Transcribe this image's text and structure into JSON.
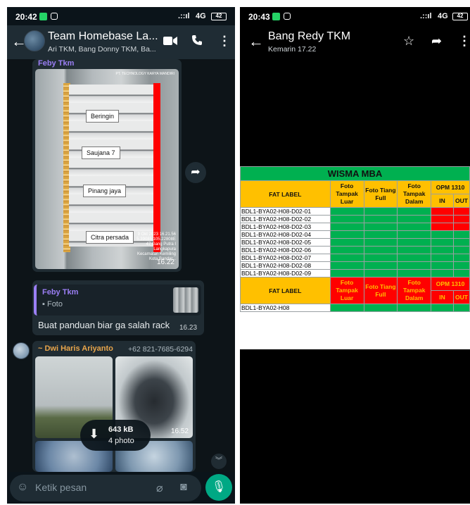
{
  "left": {
    "status": {
      "time": "20:42",
      "network": "4G",
      "battery": "42"
    },
    "header": {
      "title": "Team Homebase La...",
      "subtitle": "Ari TKM, Bang Donny TKM, Ba..."
    },
    "msg1": {
      "sender": "Feby Tkm",
      "photo": {
        "watermark_title": "PT. TECHNOLOGY KARYA MANDIRI",
        "labels": [
          "Beringin",
          "Saujana 7",
          "Pinang jaya",
          "Citra persada"
        ],
        "watermark_lines": [
          "9 Okt 2023 16.21.56",
          "5.39085 105.22808E",
          "47 Gang Putra I",
          "Langkapura",
          "Kecamatan Kemiling",
          "Kota Bandar..."
        ]
      },
      "time": "16.22"
    },
    "msg2": {
      "quote_name": "Feby Tkm",
      "quote_type": "Foto",
      "text": "Buat panduan biar ga salah rack",
      "time": "16.23"
    },
    "msg3": {
      "sender": "~ Dwi Haris Ariyanto",
      "phone": "+62 821-7685-6294",
      "photo_time": "16.52",
      "download_size": "643 kB",
      "download_count": "4 photo"
    },
    "input": {
      "placeholder": "Ketik pesan"
    }
  },
  "right": {
    "status": {
      "time": "20:43",
      "network": "4G",
      "battery": "42"
    },
    "header": {
      "title": "Bang Redy TKM",
      "subtitle": "Kemarin 17.22"
    },
    "chart_data": {
      "type": "table",
      "title": "WISMA MBA",
      "columns": [
        "FAT LABEL",
        "Foto Tampak Luar",
        "Foto Tiang Full",
        "Foto Tampak Dalam",
        "OPM 1310 IN",
        "OPM 1310 OUT"
      ],
      "rows": [
        {
          "label": "BDL1-BYA02-H08-D02-01",
          "cells": [
            "green",
            "green",
            "green",
            "red",
            "red"
          ]
        },
        {
          "label": "BDL1-BYA02-H08-D02-02",
          "cells": [
            "green",
            "green",
            "green",
            "red",
            "red"
          ]
        },
        {
          "label": "BDL1-BYA02-H08-D02-03",
          "cells": [
            "green",
            "green",
            "green",
            "red",
            "red"
          ]
        },
        {
          "label": "BDL1-BYA02-H08-D02-04",
          "cells": [
            "green",
            "green",
            "green",
            "green",
            "green"
          ]
        },
        {
          "label": "BDL1-BYA02-H08-D02-05",
          "cells": [
            "green",
            "green",
            "green",
            "green",
            "green"
          ]
        },
        {
          "label": "BDL1-BYA02-H08-D02-06",
          "cells": [
            "green",
            "green",
            "green",
            "green",
            "green"
          ]
        },
        {
          "label": "BDL1-BYA02-H08-D02-07",
          "cells": [
            "green",
            "green",
            "green",
            "green",
            "green"
          ]
        },
        {
          "label": "BDL1-BYA02-H08-D02-08",
          "cells": [
            "green",
            "green",
            "green",
            "green",
            "green"
          ]
        },
        {
          "label": "BDL1-BYA02-H08-D02-09",
          "cells": [
            "green",
            "green",
            "green",
            "green",
            "green"
          ]
        }
      ],
      "second_header": {
        "fat_label": "FAT LABEL",
        "foto_tampak_luar": "Foto Tampak Luar",
        "foto_tiang_full": "Foto Tiang Full",
        "foto_tampak_dalam": "Foto Tampak Dalam",
        "opm": "OPM 1310",
        "in": "IN",
        "out": "OUT"
      },
      "second_rows": [
        {
          "label": "BDL1-BYA02-H08",
          "cells": [
            "green",
            "green",
            "green",
            "green",
            "green"
          ]
        }
      ]
    },
    "labels": {
      "title": "WISMA MBA",
      "fat_label": "FAT LABEL",
      "foto_tampak_luar": "Foto Tampak Luar",
      "foto_tiang_full": "Foto Tiang Full",
      "foto_tampak_dalam": "Foto Tampak Dalam",
      "opm": "OPM 1310",
      "in": "IN",
      "out": "OUT"
    }
  },
  "colors": {
    "green": "#00b050",
    "red": "#ff0000",
    "yellow": "#ffc000",
    "accent": "#00a884",
    "sender": "#9b7ff5"
  }
}
